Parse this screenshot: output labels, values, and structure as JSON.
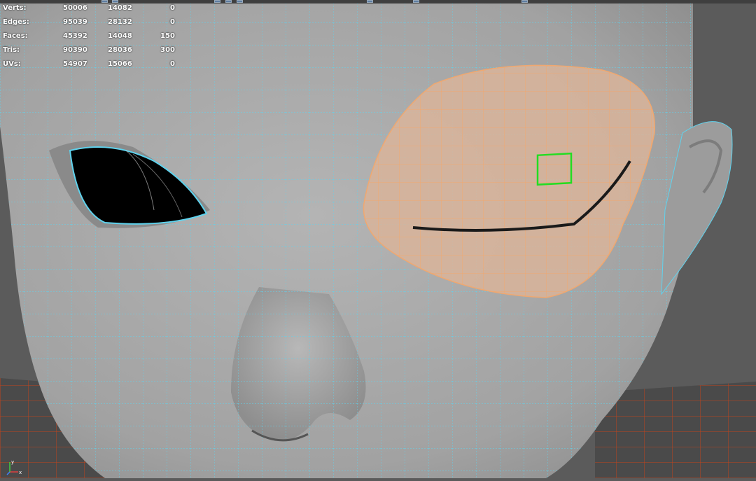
{
  "hud": {
    "rows": [
      {
        "label": "Verts:",
        "v1": "50006",
        "v2": "14082",
        "v3": "0"
      },
      {
        "label": "Edges:",
        "v1": "95039",
        "v2": "28132",
        "v3": "0"
      },
      {
        "label": "Faces:",
        "v1": "45392",
        "v2": "14048",
        "v3": "150"
      },
      {
        "label": "Tris:",
        "v1": "90390",
        "v2": "28036",
        "v3": "300"
      },
      {
        "label": "UVs:",
        "v1": "54907",
        "v2": "15066",
        "v3": "0"
      }
    ]
  },
  "colors": {
    "wireframe": "#5fd3ee",
    "selection": "#f0a870",
    "highlight_face": "#22dd22",
    "grid": "#c0441c",
    "background": "#5b5b5b"
  },
  "axis": {
    "x_label": "x",
    "y_label": "y"
  }
}
